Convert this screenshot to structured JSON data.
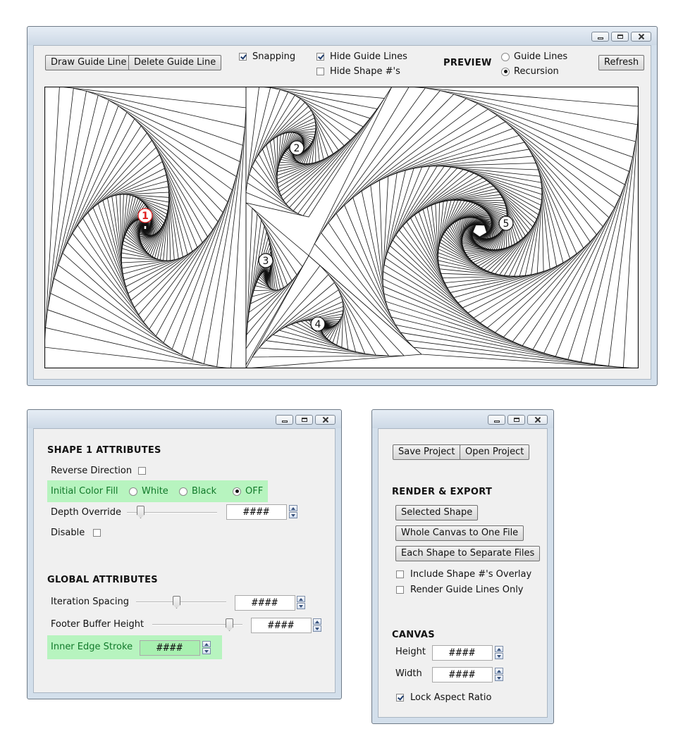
{
  "main_window": {
    "toolbar": {
      "draw_guide_line": "Draw Guide Line",
      "delete_guide_line": "Delete Guide Line",
      "snapping_label": "Snapping",
      "snapping_checked": true,
      "hide_guide_lines_label": "Hide Guide Lines",
      "hide_guide_lines_checked": true,
      "hide_shape_numbers_label": "Hide Shape #'s",
      "hide_shape_numbers_checked": false,
      "preview_label": "PREVIEW",
      "preview_options": [
        "Guide Lines",
        "Recursion"
      ],
      "preview_selected": "Recursion",
      "refresh": "Refresh"
    },
    "canvas": {
      "shape_markers": [
        "1",
        "2",
        "3",
        "4",
        "5"
      ],
      "selected_shape": "1",
      "selected_color": "#e01e1e"
    }
  },
  "shape_window": {
    "shape_header": "SHAPE 1 ATTRIBUTES",
    "reverse_direction": "Reverse Direction",
    "initial_color_fill": "Initial Color Fill",
    "color_options": [
      "White",
      "Black",
      "OFF"
    ],
    "color_selected": "OFF",
    "depth_override": "Depth Override",
    "depth_value": "####",
    "disable": "Disable",
    "global_header": "GLOBAL ATTRIBUTES",
    "iteration_spacing": "Iteration Spacing",
    "iteration_value": "####",
    "footer_buffer_height": "Footer Buffer Height",
    "footer_value": "####",
    "inner_edge_stroke": "Inner Edge Stroke",
    "stroke_value": "####",
    "highlight_color": "#b7f4bf"
  },
  "export_window": {
    "save_project": "Save Project",
    "open_project": "Open Project",
    "render_header": "RENDER & EXPORT",
    "selected_shape": "Selected Shape",
    "whole_canvas": "Whole Canvas to One File",
    "each_shape": "Each Shape to Separate Files",
    "include_overlay": "Include Shape #'s Overlay",
    "render_guides_only": "Render Guide Lines Only",
    "canvas_header": "CANVAS",
    "height_label": "Height",
    "height_value": "####",
    "width_label": "Width",
    "width_value": "####",
    "lock_aspect": "Lock Aspect Ratio",
    "lock_aspect_checked": true
  }
}
